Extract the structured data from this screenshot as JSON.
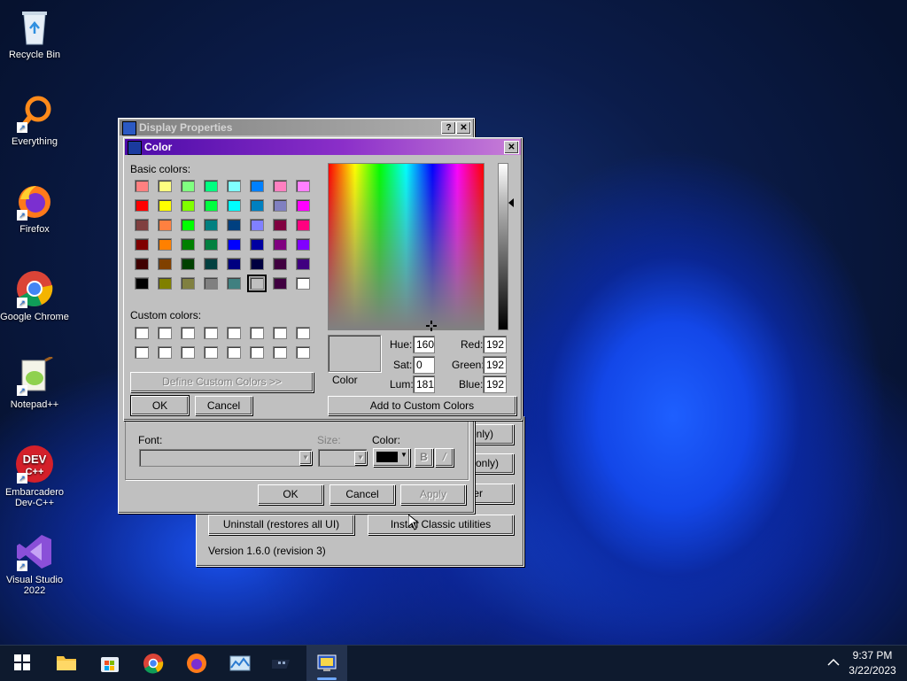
{
  "desktop": {
    "icons": [
      {
        "label": "Recycle Bin",
        "icon": "recycle-bin-icon"
      },
      {
        "label": "Everything",
        "icon": "everything-search-icon"
      },
      {
        "label": "Firefox",
        "icon": "firefox-icon"
      },
      {
        "label": "Google Chrome",
        "icon": "chrome-icon"
      },
      {
        "label": "Notepad++",
        "icon": "notepad-plus-plus-icon"
      },
      {
        "label": "Embarcadero Dev-C++",
        "label1": "Embarcadero",
        "label2": "Dev-C++",
        "icon": "devcpp-icon"
      },
      {
        "label": "Visual Studio 2022",
        "label1": "Visual Studio",
        "label2": "2022",
        "icon": "visual-studio-icon"
      }
    ]
  },
  "back_window": {
    "buttons_right": [
      "only)",
      "only)",
      "er"
    ],
    "uninstall": "Uninstall (restores all UI)",
    "install": "Install Classic utilities",
    "version": "Version 1.6.0 (revision 3)"
  },
  "display_properties": {
    "title": "Display Properties",
    "help": "?",
    "close": "✕",
    "font_label": "Font:",
    "size_label": "Size:",
    "color_label": "Color:",
    "bold": "B",
    "italic": "/",
    "ok": "OK",
    "cancel": "Cancel",
    "apply": "Apply"
  },
  "color_dialog": {
    "title": "Color",
    "close": "✕",
    "basic_colors_label": "Basic colors:",
    "custom_colors_label": "Custom colors:",
    "define_custom": "Define Custom Colors >>",
    "ok": "OK",
    "cancel": "Cancel",
    "color_label": "Color",
    "hue_label": "Hue:",
    "hue": "160",
    "sat_label": "Sat:",
    "sat": "0",
    "lum_label": "Lum:",
    "lum": "181",
    "red_label": "Red:",
    "red": "192",
    "green_label": "Green:",
    "green": "192",
    "blue_label": "Blue:",
    "blue": "192",
    "add_custom": "Add to Custom Colors",
    "basic_colors": [
      [
        "#ff8080",
        "#ffff80",
        "#80ff80",
        "#00ff80",
        "#80ffff",
        "#0080ff",
        "#ff80c0",
        "#ff80ff"
      ],
      [
        "#ff0000",
        "#ffff00",
        "#80ff00",
        "#00ff40",
        "#00ffff",
        "#0080c0",
        "#8080c0",
        "#ff00ff"
      ],
      [
        "#804040",
        "#ff8040",
        "#00ff00",
        "#008080",
        "#004080",
        "#8080ff",
        "#800040",
        "#ff0080"
      ],
      [
        "#800000",
        "#ff8000",
        "#008000",
        "#008040",
        "#0000ff",
        "#0000a0",
        "#800080",
        "#8000ff"
      ],
      [
        "#400000",
        "#804000",
        "#004000",
        "#004040",
        "#000080",
        "#000040",
        "#400040",
        "#400080"
      ],
      [
        "#000000",
        "#808000",
        "#808040",
        "#808080",
        "#408080",
        "#c0c0c0",
        "#400040",
        "#ffffff"
      ]
    ]
  },
  "taskbar": {
    "time": "9:37 PM",
    "date": "3/22/2023",
    "items": [
      "start-icon",
      "file-explorer-icon",
      "store-icon",
      "chrome-icon",
      "firefox-icon",
      "resource-monitor-icon",
      "classic-app-icon",
      "display-properties-icon"
    ]
  }
}
